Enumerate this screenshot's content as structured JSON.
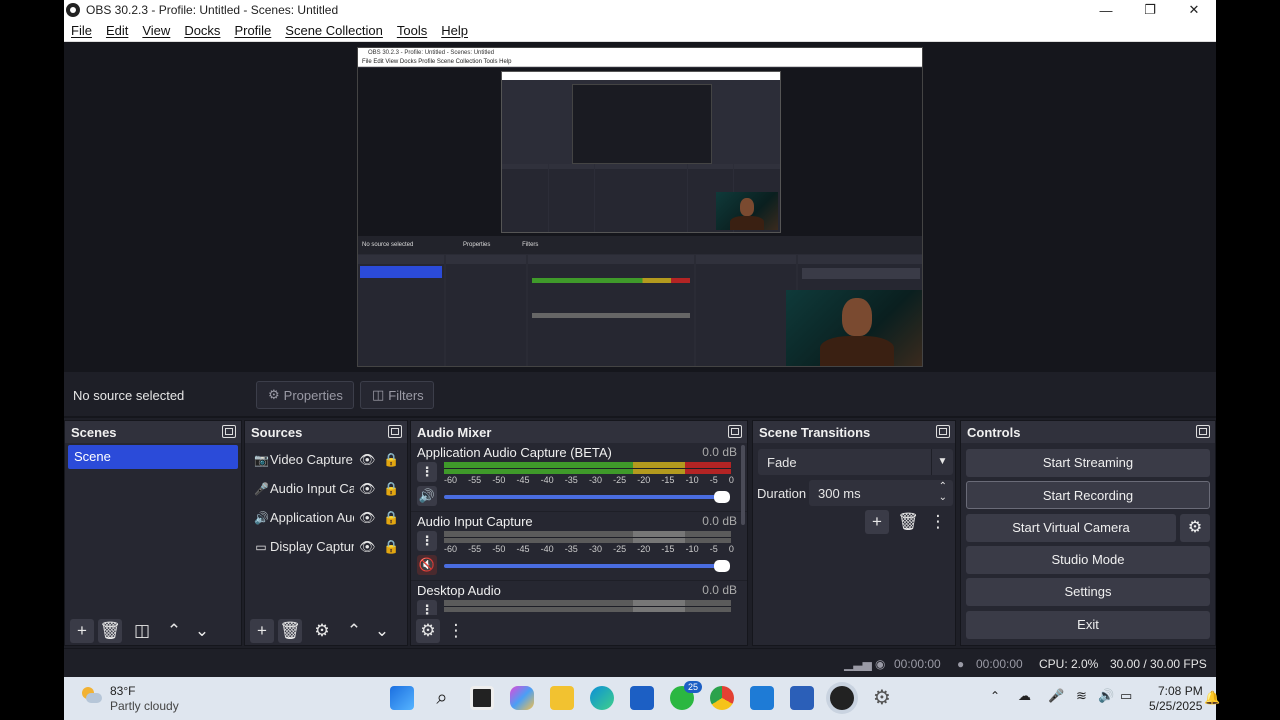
{
  "window": {
    "title": "OBS 30.2.3 - Profile: Untitled - Scenes: Untitled",
    "minimize": "—",
    "maximize": "❐",
    "close": "✕"
  },
  "menu": [
    "File",
    "Edit",
    "View",
    "Docks",
    "Profile",
    "Scene Collection",
    "Tools",
    "Help"
  ],
  "nested": {
    "title": "OBS 30.2.3 - Profile: Untitled - Scenes: Untitled",
    "menu": "File  Edit  View  Docks  Profile  Scene Collection  Tools  Help",
    "no_source": "No source selected",
    "properties": "Properties",
    "filters": "Filters"
  },
  "source_bar": {
    "no_source": "No source selected",
    "properties": "Properties",
    "filters": "Filters"
  },
  "scenes": {
    "header": "Scenes",
    "items": [
      "Scene"
    ]
  },
  "sources": {
    "header": "Sources",
    "items": [
      {
        "label": "Video Capture Device",
        "icon": "camera-icon"
      },
      {
        "label": "Audio Input Capture",
        "icon": "microphone-icon"
      },
      {
        "label": "Application Audio Capture",
        "icon": "speaker-icon"
      },
      {
        "label": "Display Capture",
        "icon": "monitor-icon"
      }
    ]
  },
  "mixer": {
    "header": "Audio Mixer",
    "ticks": [
      "-60",
      "-55",
      "-50",
      "-45",
      "-40",
      "-35",
      "-30",
      "-25",
      "-20",
      "-15",
      "-10",
      "-5",
      "0"
    ],
    "channels": [
      {
        "name": "Application Audio Capture (BETA)",
        "db": "0.0 dB",
        "muted": false,
        "level": 1.0
      },
      {
        "name": "Audio Input Capture",
        "db": "0.0 dB",
        "muted": true,
        "level": 1.0
      },
      {
        "name": "Desktop Audio",
        "db": "0.0 dB",
        "muted": false,
        "level": 1.0
      }
    ]
  },
  "transitions": {
    "header": "Scene Transitions",
    "type": "Fade",
    "duration_label": "Duration",
    "duration_value": "300 ms"
  },
  "controls": {
    "header": "Controls",
    "start_streaming": "Start Streaming",
    "start_recording": "Start Recording",
    "start_virtual_camera": "Start Virtual Camera",
    "studio_mode": "Studio Mode",
    "settings": "Settings",
    "exit": "Exit"
  },
  "status": {
    "stream_time": "00:00:00",
    "rec_time": "00:00:00",
    "cpu": "CPU: 2.0%",
    "fps": "30.00 / 30.00 FPS"
  },
  "taskbar": {
    "temp": "83°F",
    "weather": "Partly cloudy",
    "whatsapp_badge": "25",
    "time": "7:08 PM",
    "date": "5/25/2025"
  },
  "colors": {
    "accent": "#2b4bd9",
    "panel": "#262731",
    "header": "#30313c",
    "meter_green": "#3f9a2a",
    "meter_yellow": "#b39a1e",
    "meter_red": "#b32424"
  }
}
